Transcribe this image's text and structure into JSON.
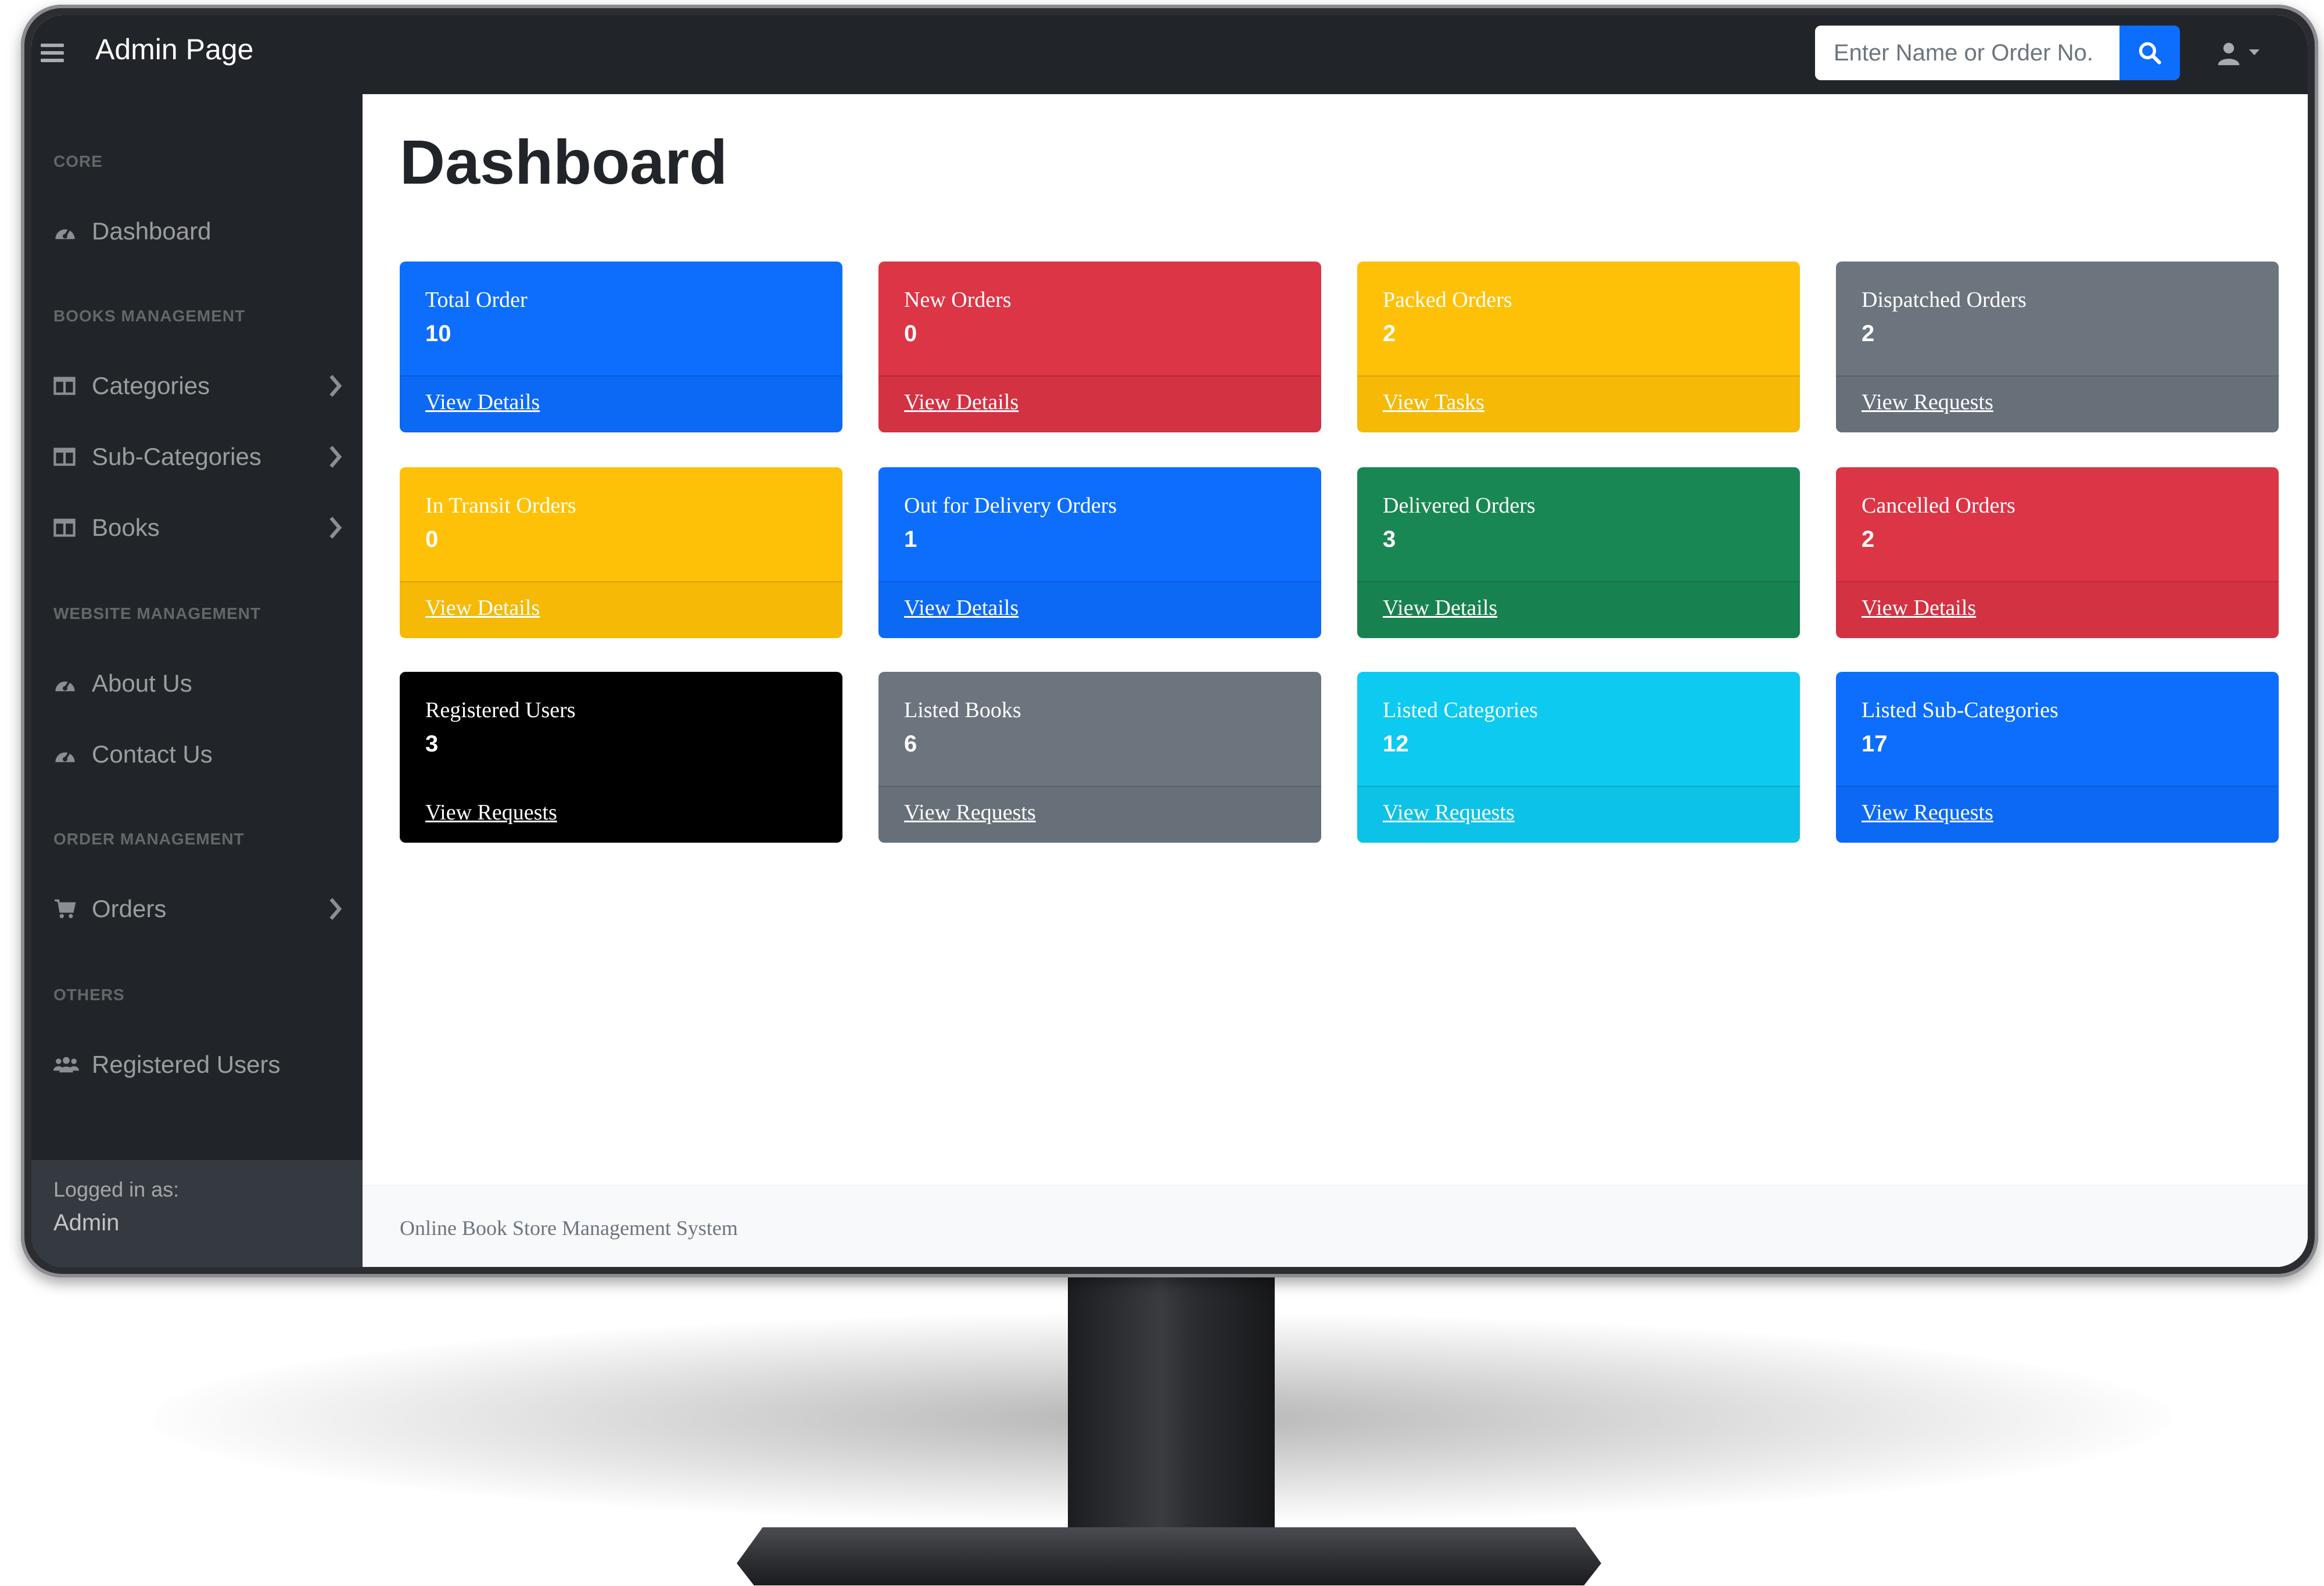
{
  "app": {
    "brand": "Admin Page",
    "search_placeholder": "Enter Name or Order No."
  },
  "sidebar": {
    "sections": [
      {
        "heading": "Core",
        "items": [
          {
            "label": "Dashboard",
            "icon": "tachometer-icon"
          }
        ]
      },
      {
        "heading": "Books Management",
        "items": [
          {
            "label": "Categories",
            "icon": "columns-icon",
            "has_submenu": true
          },
          {
            "label": "Sub-Categories",
            "icon": "columns-icon",
            "has_submenu": true
          },
          {
            "label": "Books",
            "icon": "columns-icon",
            "has_submenu": true
          }
        ]
      },
      {
        "heading": "Website Management",
        "items": [
          {
            "label": "About Us",
            "icon": "tachometer-icon"
          },
          {
            "label": "Contact Us",
            "icon": "tachometer-icon"
          }
        ]
      },
      {
        "heading": "Order Management",
        "items": [
          {
            "label": "Orders",
            "icon": "shopping-cart-icon",
            "has_submenu": true
          }
        ]
      },
      {
        "heading": "Others",
        "items": [
          {
            "label": "Registered Users",
            "icon": "users-icon"
          }
        ]
      }
    ],
    "footer": {
      "label": "Logged in as:",
      "user": "Admin"
    }
  },
  "main": {
    "title": "Dashboard",
    "cards": [
      {
        "label": "Total Order",
        "value": "10",
        "link": "View Details",
        "color": "#0d6efd"
      },
      {
        "label": "New Orders",
        "value": "0",
        "link": "View Details",
        "color": "#dc3545"
      },
      {
        "label": "Packed Orders",
        "value": "2",
        "link": "View Tasks",
        "color": "#ffc107"
      },
      {
        "label": "Dispatched Orders",
        "value": "2",
        "link": "View Requests",
        "color": "#6c757d"
      },
      {
        "label": "In Transit Orders",
        "value": "0",
        "link": "View Details",
        "color": "#ffc107"
      },
      {
        "label": "Out for Delivery Orders",
        "value": "1",
        "link": "View Details",
        "color": "#0d6efd"
      },
      {
        "label": "Delivered Orders",
        "value": "3",
        "link": "View Details",
        "color": "#198754"
      },
      {
        "label": "Cancelled Orders",
        "value": "2",
        "link": "View Details",
        "color": "#dc3545"
      },
      {
        "label": "Registered Users",
        "value": "3",
        "link": "View Requests",
        "color": "#000000"
      },
      {
        "label": "Listed Books",
        "value": "6",
        "link": "View Requests",
        "color": "#6c757d"
      },
      {
        "label": "Listed Categories",
        "value": "12",
        "link": "View Requests",
        "color": "#0dcaf0"
      },
      {
        "label": "Listed Sub-Categories",
        "value": "17",
        "link": "View Requests",
        "color": "#0d6efd"
      }
    ],
    "footer_text": "Online Book Store Management System"
  }
}
